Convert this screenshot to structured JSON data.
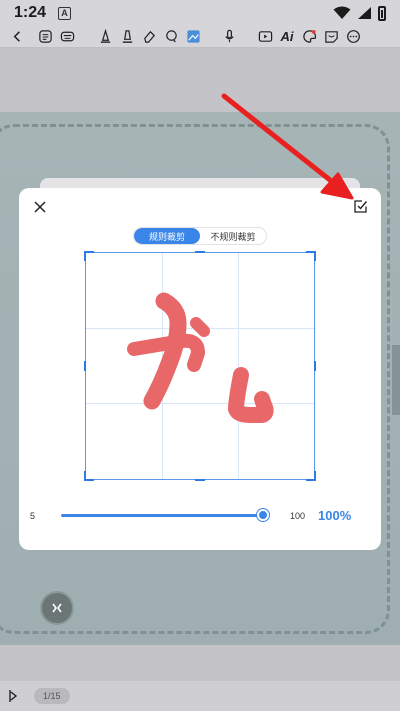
{
  "status_bar": {
    "time": "1:24",
    "notif_letter": "A"
  },
  "toolbar": {
    "ai_label": "Ai"
  },
  "modal": {
    "tabs": [
      {
        "label": "规则裁剪",
        "active": true
      },
      {
        "label": "不规则裁剪",
        "active": false
      }
    ],
    "slider": {
      "min": "5",
      "max": "100",
      "value_label": "100%",
      "value": 100
    }
  },
  "page": {
    "indicator": "1/15"
  },
  "colors": {
    "accent": "#3a86e8",
    "stroke": "#e8686a",
    "arrow": "#e82020"
  }
}
